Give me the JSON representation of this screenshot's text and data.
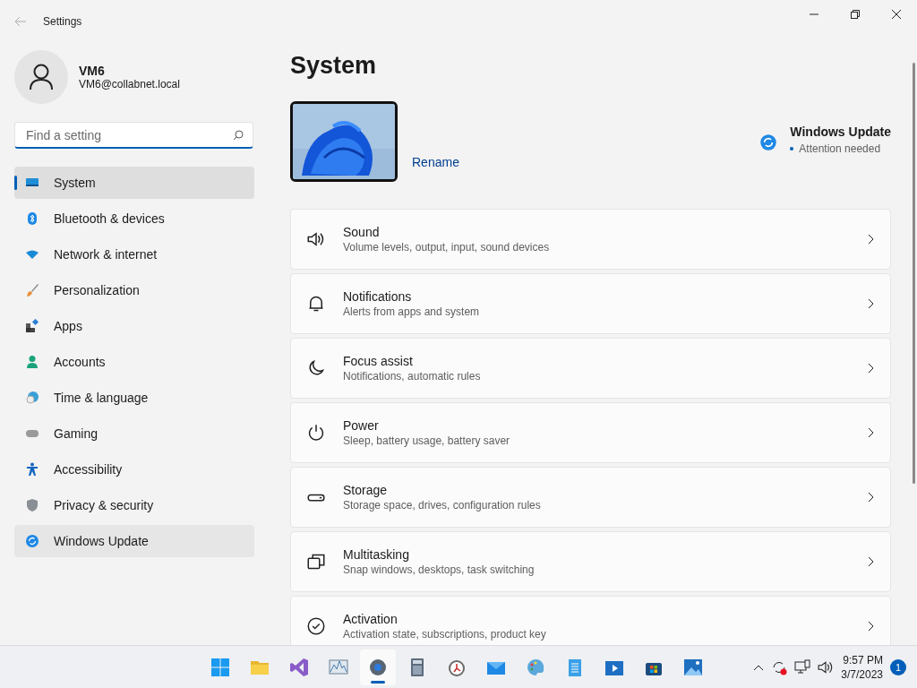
{
  "window": {
    "title": "Settings"
  },
  "account": {
    "name": "VM6",
    "email": "VM6@collabnet.local"
  },
  "search": {
    "placeholder": "Find a setting"
  },
  "sidebar": {
    "items": [
      {
        "label": "System",
        "selected": true
      },
      {
        "label": "Bluetooth & devices",
        "selected": false
      },
      {
        "label": "Network & internet",
        "selected": false
      },
      {
        "label": "Personalization",
        "selected": false
      },
      {
        "label": "Apps",
        "selected": false
      },
      {
        "label": "Accounts",
        "selected": false
      },
      {
        "label": "Time & language",
        "selected": false
      },
      {
        "label": "Gaming",
        "selected": false
      },
      {
        "label": "Accessibility",
        "selected": false
      },
      {
        "label": "Privacy & security",
        "selected": false
      },
      {
        "label": "Windows Update",
        "selected": false,
        "hovered": true
      }
    ]
  },
  "page": {
    "title": "System",
    "rename": "Rename",
    "update": {
      "title": "Windows Update",
      "status": "Attention needed"
    },
    "cards": [
      {
        "title": "Sound",
        "subtitle": "Volume levels, output, input, sound devices"
      },
      {
        "title": "Notifications",
        "subtitle": "Alerts from apps and system"
      },
      {
        "title": "Focus assist",
        "subtitle": "Notifications, automatic rules"
      },
      {
        "title": "Power",
        "subtitle": "Sleep, battery usage, battery saver"
      },
      {
        "title": "Storage",
        "subtitle": "Storage space, drives, configuration rules"
      },
      {
        "title": "Multitasking",
        "subtitle": "Snap windows, desktops, task switching"
      },
      {
        "title": "Activation",
        "subtitle": "Activation state, subscriptions, product key"
      }
    ]
  },
  "taskbar": {
    "time": "9:57 PM",
    "date": "3/7/2023",
    "notifications": "1"
  }
}
